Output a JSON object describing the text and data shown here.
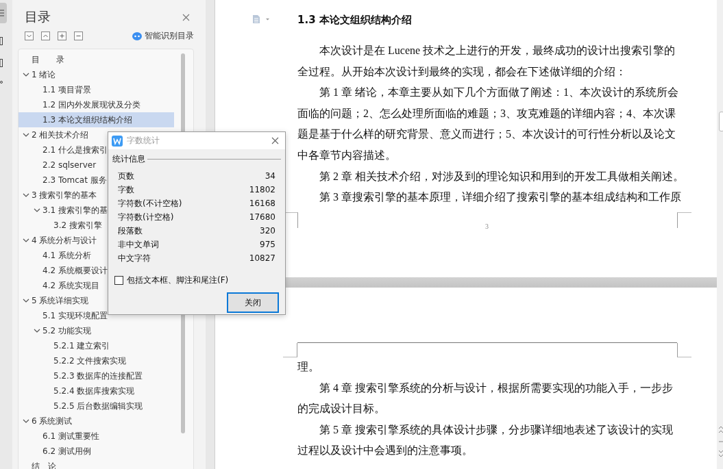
{
  "toc": {
    "title": "目录",
    "smart_button": "智能识别目录",
    "items": [
      {
        "text": "目　　录",
        "selected": false
      },
      {
        "text": "1  绪论",
        "selected": false,
        "expanded": true,
        "children": [
          {
            "text": "1.1  项目背景",
            "selected": false
          },
          {
            "text": "1.2  国内外发展现状及分类",
            "selected": false
          },
          {
            "text": "1.3  本论文组织结构介绍",
            "selected": true
          }
        ]
      },
      {
        "text": "2  相关技术介绍",
        "selected": false,
        "expanded": true,
        "children": [
          {
            "text": "2.1 什么是搜索引",
            "selected": false
          },
          {
            "text": "2.2   sqlserver",
            "selected": false
          },
          {
            "text": "2.3 Tomcat 服务",
            "selected": false
          }
        ]
      },
      {
        "text": "3  搜索引擎的基本",
        "selected": false,
        "expanded": true,
        "children": [
          {
            "text": "3.1 搜索引擎的基",
            "selected": false,
            "expanded": true,
            "children": [
              {
                "text": "3.2 搜索引擎",
                "selected": false
              }
            ]
          }
        ]
      },
      {
        "text": "4  系统分析与设计",
        "selected": false,
        "expanded": true,
        "children": [
          {
            "text": "4.1 系统分析",
            "selected": false
          },
          {
            "text": "4.2 系统概要设计",
            "selected": false
          },
          {
            "text": "4.2 系统实现目",
            "selected": false
          }
        ]
      },
      {
        "text": "5  系统详细实现",
        "selected": false,
        "expanded": true,
        "children": [
          {
            "text": "5.1 实现环境配置",
            "selected": false
          },
          {
            "text": "5.2 功能实现",
            "selected": false,
            "expanded": true,
            "children": [
              {
                "text": "5.2.1    建立索引",
                "selected": false
              },
              {
                "text": "5.2.2    文件搜索实现",
                "selected": false
              },
              {
                "text": "5.2.3    数据库的连接配置",
                "selected": false
              },
              {
                "text": "5.2.4    数据库搜索实现",
                "selected": false
              },
              {
                "text": "5.2.5    后台数据编辑实现",
                "selected": false
              }
            ]
          }
        ]
      },
      {
        "text": "6  系统测试",
        "selected": false,
        "expanded": true,
        "children": [
          {
            "text": "6.1 测试重要性",
            "selected": false
          },
          {
            "text": "6.2 测试用例",
            "selected": false
          }
        ]
      },
      {
        "text": "结　论",
        "selected": false
      }
    ]
  },
  "document": {
    "heading": "1.3  本论文组织结构介绍",
    "page1_paragraphs": [
      {
        "lines": [
          "本次设计是在 Lucene 技术之上进行的开发，最终成功的设计出搜索引擎的",
          "全过程。从开始本次设计到最终的实现，都会在下述做详细的介绍："
        ]
      },
      {
        "lines": [
          "第 1 章 绪论，本章主要从如下几个方面做了阐述：1、本次设计的系统所会",
          "面临的问题；2、怎么处理所面临的难题；3、攻克难题的详细内容；4、本次课",
          "题是基于什么样的研究背景、意义而进行；5、本次设计的可行性分析以及论文",
          "中各章节内容描述。"
        ]
      },
      {
        "lines": [
          "第 2 章 相关技术介绍，对涉及到的理论知识和用到的开发工具做相关阐述。"
        ]
      },
      {
        "lines": [
          "第 3 章搜索引擎的基本原理，详细介绍了搜索引擎的基本组成结构和工作原"
        ]
      }
    ],
    "page_number": "3",
    "page2_paragraphs": [
      {
        "lines": [
          "理。"
        ]
      },
      {
        "lines": [
          "第 4 章 搜索引擎系统的分析与设计，根据所需要实现的功能入手，一步步",
          "的完成设计目标。"
        ]
      },
      {
        "lines": [
          "第 5 章 搜索引擎系统的具体设计步骤，分步骤详细地表述了该设计的实现",
          "过程以及设计中会遇到的注意事项。"
        ]
      }
    ]
  },
  "dialog": {
    "title": "字数统计",
    "group": "统计信息",
    "stats": [
      {
        "label": "页数",
        "value": "34"
      },
      {
        "label": "字数",
        "value": "11802"
      },
      {
        "label": "字符数(不计空格)",
        "value": "16168"
      },
      {
        "label": "字符数(计空格)",
        "value": "17680"
      },
      {
        "label": "段落数",
        "value": "320"
      },
      {
        "label": "非中文单词",
        "value": "975"
      },
      {
        "label": "中文字符",
        "value": "10827"
      }
    ],
    "checkbox": {
      "label": "包括文本框、脚注和尾注(F)",
      "checked": false
    },
    "button": "关闭"
  }
}
